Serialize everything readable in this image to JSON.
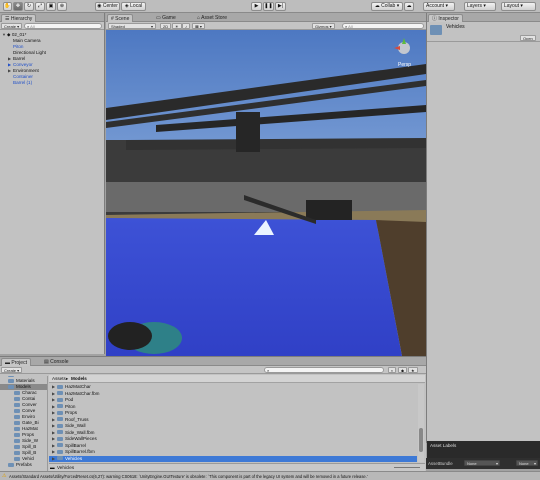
{
  "toolbar": {
    "pivot_label": "Center",
    "space_label": "Local",
    "collab_label": "Collab",
    "account_label": "Account",
    "layers_label": "Layers",
    "layout_label": "Layout"
  },
  "hierarchy": {
    "tab_label": "Hierarchy",
    "create_label": "Create",
    "search_placeholder": "All",
    "scene_name": "02_01*",
    "items": [
      {
        "label": "Main Camera",
        "indent": 1,
        "expandable": false,
        "prefab": false
      },
      {
        "label": "Piton",
        "indent": 1,
        "expandable": false,
        "prefab": true
      },
      {
        "label": "Directional Light",
        "indent": 1,
        "expandable": false,
        "prefab": false
      },
      {
        "label": "Barrel",
        "indent": 1,
        "expandable": true,
        "prefab": false
      },
      {
        "label": "Conveyor",
        "indent": 1,
        "expandable": true,
        "prefab": true
      },
      {
        "label": "Environment",
        "indent": 1,
        "expandable": true,
        "prefab": false
      },
      {
        "label": "Container",
        "indent": 1,
        "expandable": false,
        "prefab": true
      },
      {
        "label": "Barrel (1)",
        "indent": 1,
        "expandable": false,
        "prefab": true
      }
    ]
  },
  "scene": {
    "tabs": [
      "Scene",
      "Game",
      "Asset Store"
    ],
    "shading_mode": "Shaded",
    "mode_2d": "2D",
    "gizmos_label": "Gizmos",
    "persp_label": "Persp"
  },
  "inspector": {
    "tab_label": "Inspector",
    "object_name": "Vehicles",
    "open_label": "Open"
  },
  "project": {
    "tabs": [
      "Project",
      "Console"
    ],
    "create_label": "Create",
    "breadcrumb": [
      "Assets",
      "Models"
    ],
    "tree_items": [
      "Effects",
      "Materials",
      "Models",
      "Charac",
      "Contai",
      "Conver",
      "Conve",
      "Enviro",
      "Gate_Bi",
      "HazMat",
      "Props",
      "Side_W",
      "Spill_B",
      "Spill_B",
      "Vehicl",
      "Prefabs"
    ],
    "selected_tree_item": "Models",
    "files": [
      {
        "label": "HazMatChar",
        "type": "folder"
      },
      {
        "label": "HazMatChar.fbm",
        "type": "folder"
      },
      {
        "label": "Pod",
        "type": "folder"
      },
      {
        "label": "Piton",
        "type": "folder"
      },
      {
        "label": "Props",
        "type": "folder"
      },
      {
        "label": "Roof_Truss",
        "type": "folder"
      },
      {
        "label": "Side_Wall",
        "type": "folder"
      },
      {
        "label": "Side_Wall.fbm",
        "type": "folder"
      },
      {
        "label": "SideWallPieces",
        "type": "folder"
      },
      {
        "label": "SpillBarrel",
        "type": "folder"
      },
      {
        "label": "SpillBarrel.fbm",
        "type": "folder"
      },
      {
        "label": "Vehicles",
        "type": "folder"
      }
    ],
    "selected_file": "Vehicles",
    "footer_path": "Vehicles"
  },
  "asset_labels": {
    "title": "Asset Labels",
    "assetbundle_label": "AssetBundle",
    "none_left": "None",
    "none_right": "None"
  },
  "status_bar": {
    "message": "Assets/Standard Assets/Utility/ForcedReset.cs(6,27): warning CS0618: `UnityEngine.GUITexture' is obsolete: `This component is part of the legacy UI system and will be removed in a future release.'"
  },
  "colors": {
    "accent_blue": "#3d79d6",
    "prefab_blue": "#1f4fc9",
    "water_blue": "#3a46d8",
    "sky_blue": "#8eb6e6"
  }
}
